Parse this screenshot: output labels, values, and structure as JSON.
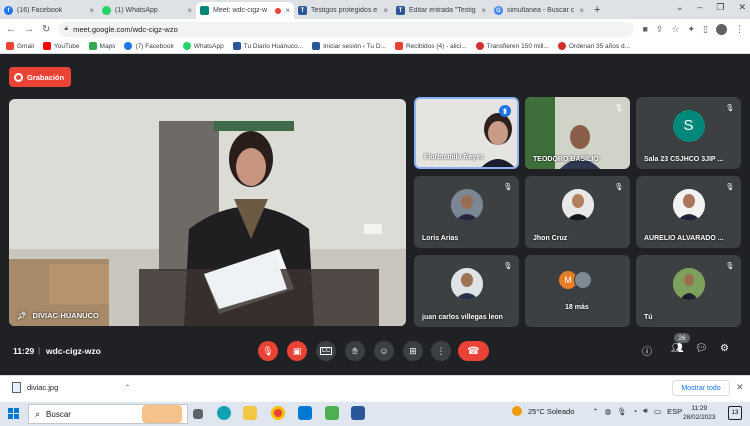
{
  "tabs": [
    {
      "label": "(16) Facebook",
      "color": "#1877f2",
      "active": false
    },
    {
      "label": "(1) WhatsApp",
      "color": "#25d366",
      "active": false
    },
    {
      "label": "Meet: wdc-cigz-w",
      "color": "#00897b",
      "active": true
    },
    {
      "label": "Testigos protegidos e",
      "color": "#2b5797",
      "active": false
    },
    {
      "label": "Editar entrada \"Testig",
      "color": "#2b5797",
      "active": false
    },
    {
      "label": "simultanea - Buscar c",
      "color": "#4285f4",
      "active": false
    }
  ],
  "address": {
    "url": "meet.google.com/wdc-cigz-wzo"
  },
  "bookmarks": [
    {
      "label": "Gmail",
      "color": "#ea4335"
    },
    {
      "label": "YouTube",
      "color": "#ff0000"
    },
    {
      "label": "Maps",
      "color": "#34a853"
    },
    {
      "label": "(7) Facebook",
      "color": "#1877f2"
    },
    {
      "label": "WhatsApp",
      "color": "#25d366"
    },
    {
      "label": "Tu Diario Huánuco...",
      "color": "#2b5797"
    },
    {
      "label": "Iniciar sesión ‹ Tu D...",
      "color": "#2b5797"
    },
    {
      "label": "Recibidos (4) - alici...",
      "color": "#ea4335"
    },
    {
      "label": "Transfieren 150 mill...",
      "color": "#d32f2f"
    },
    {
      "label": "Ordenan 35 años d...",
      "color": "#d32f2f"
    }
  ],
  "meet": {
    "recording_label": "Grabación",
    "main_speaker": "DIVIAC-HUANUCO",
    "participants": [
      {
        "name": "Florinsmila Reyes",
        "speaking": true
      },
      {
        "name": "TEODORO BASILIO",
        "speaking": false
      },
      {
        "name": "Sala 23 CSJHCO 3JIP ...",
        "initial": "S",
        "speaking": false
      },
      {
        "name": "Loris Arias",
        "speaking": false
      },
      {
        "name": "Jhon Cruz",
        "speaking": false
      },
      {
        "name": "AURELIO ALVARADO ...",
        "speaking": false
      },
      {
        "name": "juan carlos villegas leon",
        "speaking": false
      },
      {
        "name": "18 más",
        "initial": "M",
        "speaking": false
      },
      {
        "name": "Tú",
        "speaking": false
      }
    ],
    "time": "11:29",
    "meeting_code": "wdc-cigz-wzo",
    "participant_count": "26"
  },
  "download": {
    "filename": "diviac.jpg",
    "show_all": "Mostrar todo"
  },
  "taskbar": {
    "search_label": "Buscar",
    "weather": "25°C  Soleado",
    "lang": "ESP",
    "time": "11:29",
    "date": "28/02/2023",
    "notif": "13"
  }
}
